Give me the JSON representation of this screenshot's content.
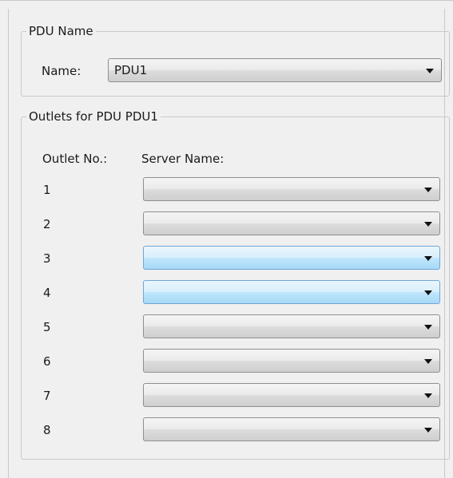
{
  "pdu_group": {
    "legend": "PDU Name",
    "name_label": "Name:",
    "name_value": "PDU1"
  },
  "outlets_group": {
    "legend": "Outlets for PDU PDU1",
    "col_outlet": "Outlet No.:",
    "col_server": "Server Name:",
    "rows": [
      {
        "number": "1",
        "server": "",
        "highlighted": false
      },
      {
        "number": "2",
        "server": "",
        "highlighted": false
      },
      {
        "number": "3",
        "server": "",
        "highlighted": true
      },
      {
        "number": "4",
        "server": "",
        "highlighted": true
      },
      {
        "number": "5",
        "server": "",
        "highlighted": false
      },
      {
        "number": "6",
        "server": "",
        "highlighted": false
      },
      {
        "number": "7",
        "server": "",
        "highlighted": false
      },
      {
        "number": "8",
        "server": "",
        "highlighted": false
      }
    ]
  },
  "icons": {
    "dropdown": "chevron-down-icon"
  },
  "colors": {
    "background": "#f0f0f0",
    "group_border": "#c9c9c9",
    "combo_highlight": "#bee6fd"
  }
}
